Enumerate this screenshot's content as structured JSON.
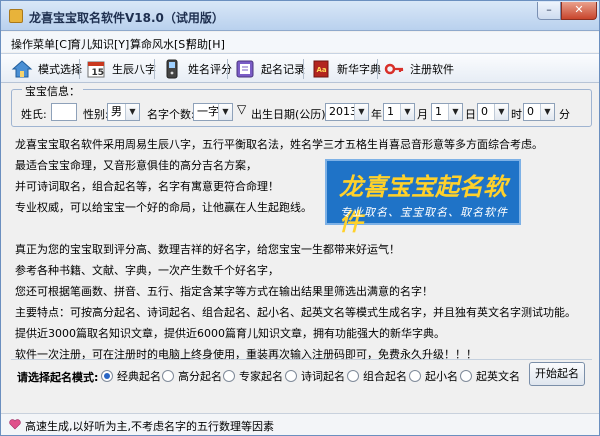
{
  "window": {
    "title": "龙喜宝宝取名软件V18.0（试用版）",
    "minimize": "–",
    "close": "✕"
  },
  "menu": [
    "操作菜单[C]",
    "育儿知识[Y]",
    "算命风水[S]",
    "帮助[H]"
  ],
  "toolbar": [
    {
      "label": "模式选择",
      "icon": "house-icon"
    },
    {
      "label": "生辰八字",
      "icon": "calendar-icon"
    },
    {
      "label": "姓名评分",
      "icon": "phone-icon"
    },
    {
      "label": "起名记录",
      "icon": "book-icon"
    },
    {
      "label": "新华字典",
      "icon": "dictionary-icon"
    },
    {
      "label": "注册软件",
      "icon": "key-icon"
    }
  ],
  "baby_info": {
    "group_title": "宝宝信息：",
    "surname_label": "姓氏:",
    "surname_value": "",
    "gender_label": "性别:",
    "gender_value": "男",
    "count_label": "名字个数:",
    "count_value": "一字",
    "dob_label": "出生日期(公历):",
    "year_value": "2013",
    "year_label": "年",
    "month_value": "1",
    "month_label": "月",
    "day_value": "1",
    "day_label": "日",
    "hour_value": "0",
    "hour_label": "时",
    "minute_value": "0",
    "minute_label": "分"
  },
  "intro_lines": [
    "龙喜宝宝取名软件采用周易生辰八字，五行平衡取名法，姓名学三才五格生肖喜忌音形意等多方面综合考虑。",
    "最适合宝宝命理，又音形意俱佳的高分吉名方案，",
    "并可诗词取名，组合起名等，名字有寓意更符合命理！",
    "专业权威，可以给宝宝一个好的命局，让他赢在人生起跑线。",
    "",
    "真正为您的宝宝取到评分高、数理吉祥的好名字，给您宝宝一生都带来好运气！",
    "参考各种书籍、文献、字典，一次产生数千个好名字，",
    "您还可根据笔画数、拼音、五行、指定含某字等方式在输出结果里筛选出满意的名字！",
    "主要特点：可按高分起名、诗词起名、组合起名、起小名、起英文名等模式生成名字，并且独有英文名字测试功能。",
    "提供近3000篇取名知识文章，提供近6000篇育儿知识文章，拥有功能强大的新华字典。",
    "软件一次注册，可在注册时的电脑上终身使用，重装再次输入注册码即可，免费永久升级！！！"
  ],
  "banner": {
    "title": "龙喜宝宝起名软件",
    "subtitle": "专业取名、宝宝取名、取名软件"
  },
  "mode": {
    "label": "请选择起名模式:",
    "options": [
      "经典起名",
      "高分起名",
      "专家起名",
      "诗词起名",
      "组合起名",
      "起小名",
      "起英文名"
    ],
    "selected": 0,
    "start_button": "开始起名"
  },
  "status": {
    "text": "高速生成,以好听为主,不考虑名字的五行数理等因素"
  },
  "colors": {
    "banner_bg": "#1f73c7",
    "banner_text": "#ffd12b",
    "radio_dot": "#2a66c5"
  }
}
